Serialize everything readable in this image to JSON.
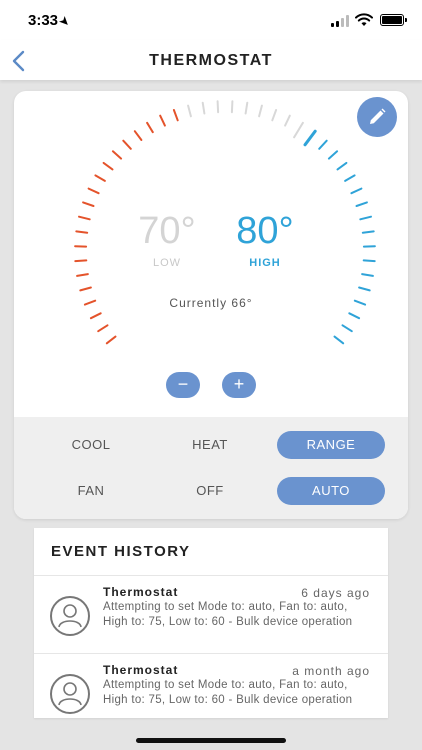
{
  "status_bar": {
    "time": "3:33"
  },
  "nav": {
    "title": "THERMOSTAT"
  },
  "thermostat": {
    "low_temp": "70°",
    "low_label": "LOW",
    "high_temp": "80°",
    "high_label": "HIGH",
    "current": "Currently 66°",
    "minus": "−",
    "plus": "+",
    "colors": {
      "heat": "#e4532b",
      "cool": "#2fa3d8",
      "idle": "#d8d8d8",
      "accent": "#6a93cf"
    }
  },
  "modes": {
    "cool": "COOL",
    "heat": "HEAT",
    "range": "RANGE",
    "fan": "FAN",
    "off": "OFF",
    "auto": "AUTO",
    "selected_mode": "RANGE",
    "selected_fan": "AUTO"
  },
  "event_history": {
    "title": "EVENT HISTORY",
    "events": [
      {
        "name": "Thermostat",
        "time": "6 days ago",
        "description": "Attempting to set Mode to: auto, Fan to: auto, High to: 75, Low to: 60 - Bulk device operation"
      },
      {
        "name": "Thermostat",
        "time": "a month ago",
        "description": "Attempting to set Mode to: auto, Fan to: auto, High to: 75, Low to: 60 - Bulk device operation"
      }
    ]
  },
  "icons": {
    "back": "chevron-left-icon",
    "edit": "pencil-icon",
    "avatar": "user-icon"
  }
}
